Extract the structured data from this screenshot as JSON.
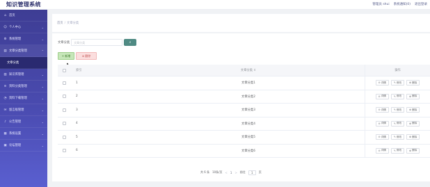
{
  "app": {
    "title": "知识管理系统"
  },
  "header": {
    "user_items": [
      "管理员 shui",
      "系统通知(0)",
      "退出登录"
    ]
  },
  "sidebar": {
    "items": [
      {
        "icon": "home-icon",
        "label": "首页",
        "has_children": false,
        "active": false
      },
      {
        "icon": "user-icon",
        "label": "个人中心",
        "has_children": true,
        "active": false
      },
      {
        "icon": "settings-icon",
        "label": "系统管理",
        "has_children": true,
        "active": false
      },
      {
        "icon": "document-icon",
        "label": "文章分类管理",
        "has_children": true,
        "active": true
      },
      {
        "icon": "",
        "label": "文章分类",
        "has_children": false,
        "active": false,
        "sub": true
      },
      {
        "icon": "book-icon",
        "label": "知识库管理",
        "has_children": true,
        "active": false
      },
      {
        "icon": "list-icon",
        "label": "资料分类管理",
        "has_children": true,
        "active": false
      },
      {
        "icon": "chart-icon",
        "label": "资料下载管理",
        "has_children": true,
        "active": false
      },
      {
        "icon": "message-icon",
        "label": "留言板管理",
        "has_children": true,
        "active": false
      },
      {
        "icon": "notice-icon",
        "label": "公告管理",
        "has_children": true,
        "active": false
      },
      {
        "icon": "grid-icon",
        "label": "系统设置",
        "has_children": true,
        "active": false
      },
      {
        "icon": "folder-icon",
        "label": "论坛管理",
        "has_children": true,
        "active": false
      }
    ]
  },
  "breadcrumb": {
    "home": "首页",
    "separator": "/",
    "current": "文章分类"
  },
  "search": {
    "label": "文章分类",
    "placeholder": "文章分类",
    "value": "",
    "button_icon": "search-icon"
  },
  "actions": {
    "add_label": "+ 新增",
    "delete_label": "⊗ 删除"
  },
  "table": {
    "columns": {
      "no": "索引",
      "name": "文章分类 ⇕",
      "operation": "操作"
    },
    "rows": [
      {
        "no": "1",
        "name": "文章分类1"
      },
      {
        "no": "2",
        "name": "文章分类2"
      },
      {
        "no": "3",
        "name": "文章分类3"
      },
      {
        "no": "4",
        "name": "文章分类4"
      },
      {
        "no": "5",
        "name": "文章分类5"
      },
      {
        "no": "6",
        "name": "文章分类6"
      }
    ],
    "row_actions": {
      "view": "详情",
      "edit": "修改",
      "delete": "删除"
    }
  },
  "pagination": {
    "total_text": "共 6 条",
    "page_size_text": "10条/页",
    "prev": "<",
    "current_page": "1",
    "next": ">",
    "goto_label": "前往",
    "goto_value": "1",
    "goto_suffix": "页"
  },
  "colors": {
    "sidebar_top": "#3e3d94",
    "sidebar_bottom": "#5a5fd0",
    "search_button": "#4f8a83",
    "add_button": "#c6e6b9",
    "delete_button": "#fbdede"
  }
}
